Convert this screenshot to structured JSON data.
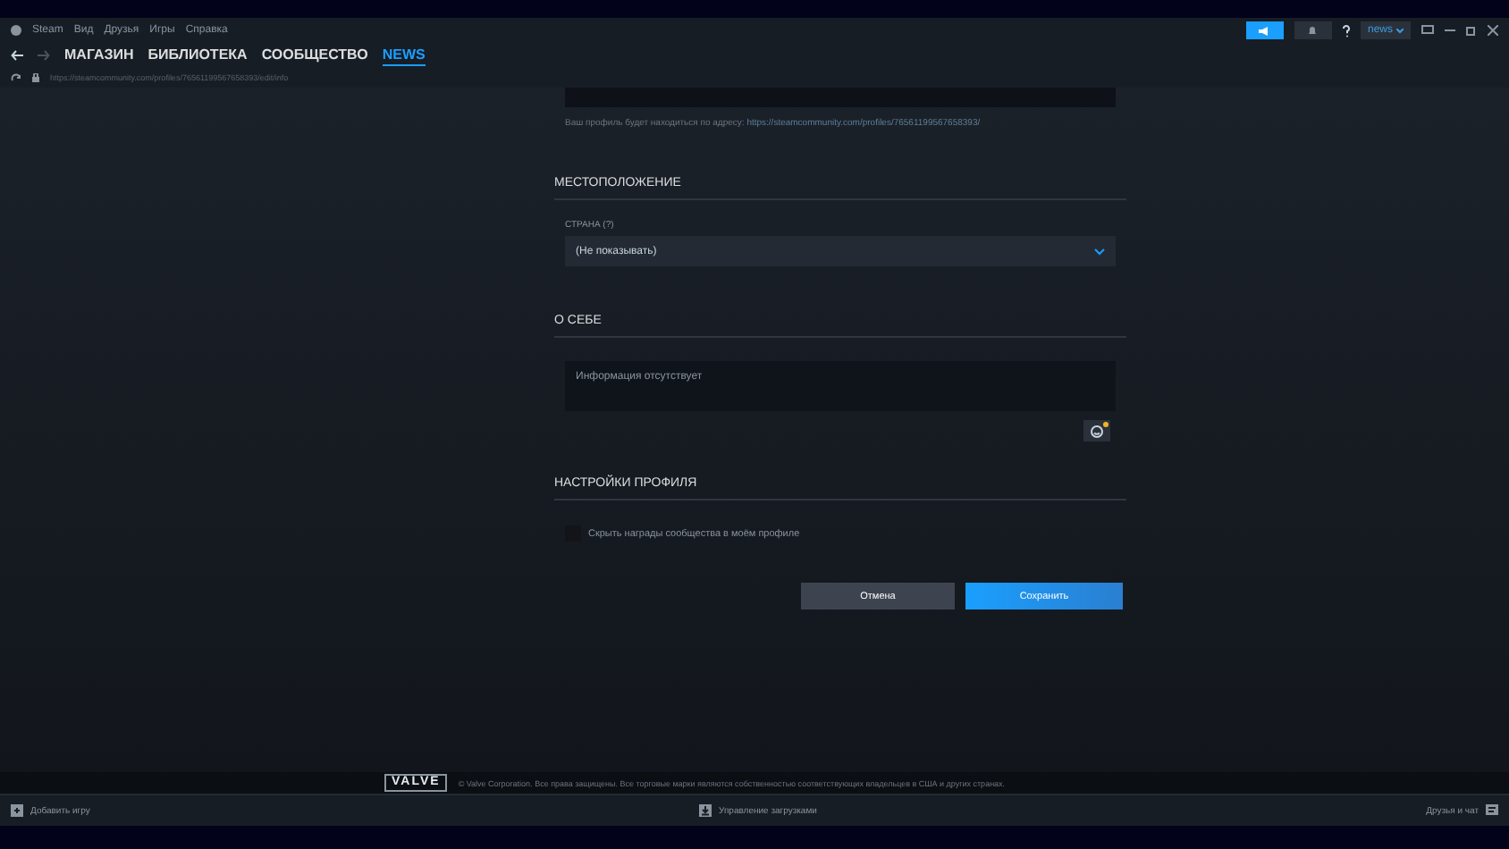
{
  "menu": [
    "Steam",
    "Вид",
    "Друзья",
    "Игры",
    "Справка"
  ],
  "account": {
    "name": "news"
  },
  "nav": [
    {
      "label": "МАГАЗИН",
      "selected": false
    },
    {
      "label": "БИБЛИОТЕКА",
      "selected": false
    },
    {
      "label": "СООБЩЕСТВО",
      "selected": false
    },
    {
      "label": "NEWS",
      "selected": true
    }
  ],
  "url": "https://steamcommunity.com/profiles/76561199567658393/edit/info",
  "profile_url_note": {
    "text": "Ваш профиль будет находиться по адресу:",
    "link": "https://steamcommunity.com/profiles/76561199567658393/"
  },
  "location": {
    "heading": "МЕСТОПОЛОЖЕНИЕ",
    "country_label": "СТРАНА",
    "country_hint": "(?)",
    "country_value": "(Не показывать)"
  },
  "about": {
    "heading": "О СЕБЕ",
    "placeholder": "Информация отсутствует"
  },
  "settings": {
    "heading": "НАСТРОЙКИ ПРОФИЛЯ",
    "options": [
      {
        "label": "Скрыть награды сообщества в моём профиле",
        "checked": false
      }
    ]
  },
  "buttons": {
    "cancel": "Отмена",
    "save": "Сохранить"
  },
  "footer": {
    "logo": "VALVE",
    "copyright": "© Valve Corporation. Все права защищены. Все торговые марки являются собственностью соответствующих владельцев в США и других странах."
  },
  "bottom_bar": {
    "add_game": "Добавить игру",
    "downloads": "Управление загрузками",
    "friends": "Друзья и чат"
  }
}
